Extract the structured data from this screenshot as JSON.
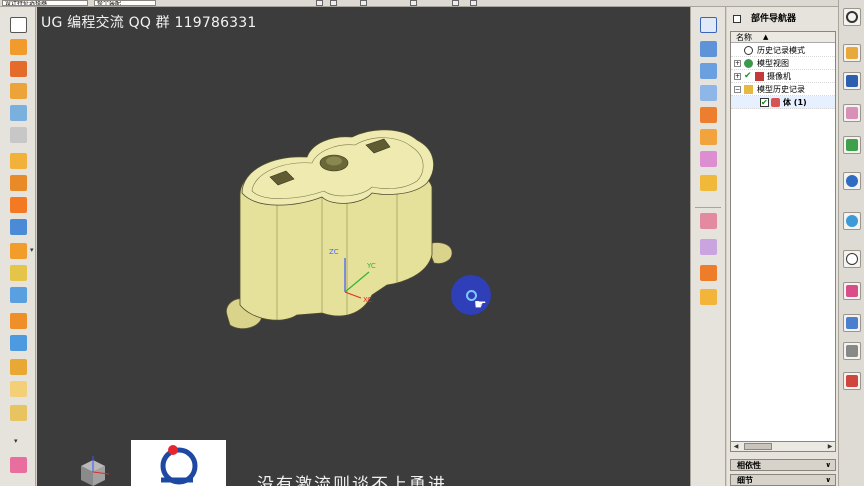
{
  "topbar": {
    "field1": "设计特征选择器",
    "field2": "整个装配"
  },
  "viewport": {
    "title": "UG 编程交流 QQ 群 119786331",
    "subtitle": "没有激流则谈不上勇进",
    "axis_z": "ZC",
    "axis_x": "XC",
    "axis_y": "YC",
    "background": "#3c3c3c",
    "model_color": "#e6e19a"
  },
  "navigator": {
    "title": "部件导航器",
    "column_name": "名称",
    "items": [
      {
        "label": "历史记录模式",
        "icon": "clock-icon"
      },
      {
        "label": "模型视图",
        "icon": "views-icon"
      },
      {
        "label": "摄像机",
        "icon": "camera-icon"
      },
      {
        "label": "模型历史记录",
        "icon": "folder-icon"
      },
      {
        "label": "体 (1)",
        "icon": "body-icon"
      }
    ],
    "panels": [
      {
        "label": "相依性"
      },
      {
        "label": "细节"
      }
    ]
  },
  "icons": {
    "left_toolbar": [
      "sketch-icon",
      "extrude-icon",
      "revolve-icon",
      "block-icon",
      "cylinder-icon",
      "cone-icon",
      "edge-blend-icon",
      "chamfer-icon",
      "hole-icon",
      "boss-icon",
      "pad-icon",
      "pocket-icon",
      "slot-icon",
      "groove-icon",
      "unite-icon",
      "subtract-icon",
      "intersect-icon",
      "trim-icon",
      "offset-icon",
      "pattern-icon",
      "mirror-icon",
      "shell-icon"
    ],
    "right_toolbar": [
      "view-fit-icon",
      "view-zoom-icon",
      "view-rotate-icon",
      "view-pan-icon",
      "shade-icon",
      "wireframe-icon",
      "render-icon",
      "perspective-icon",
      "section-icon",
      "layer-icon",
      "hide-icon",
      "show-icon",
      "color-icon"
    ],
    "resource_bar": [
      "settings-icon",
      "assembly-navigator-icon",
      "constraint-navigator-icon",
      "part-navigator-icon",
      "reuse-library-icon",
      "hd3d-icon",
      "web-browser-icon",
      "history-icon",
      "process-studio-icon",
      "manufacturing-wizard-icon",
      "roles-icon",
      "system-materials-icon"
    ]
  }
}
